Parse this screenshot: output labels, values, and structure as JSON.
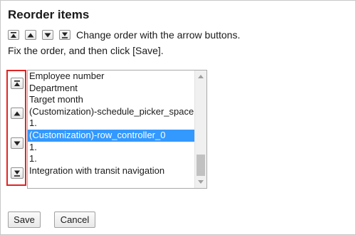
{
  "header": {
    "title": "Reorder items"
  },
  "instructions": {
    "line1": "Change order with the arrow buttons.",
    "line2": "Fix the order, and then click [Save]."
  },
  "legend_icons": [
    "move-to-top-icon",
    "move-up-icon",
    "move-down-icon",
    "move-to-bottom-icon"
  ],
  "arrow_buttons": [
    "move-to-top-icon",
    "move-up-icon",
    "move-down-icon",
    "move-to-bottom-icon"
  ],
  "list": {
    "items": [
      "Employee number",
      "Department",
      "Target month",
      "(Customization)-schedule_picker_space",
      "1.",
      "(Customization)-row_controller_0",
      "1.",
      "1.",
      "Integration with transit navigation"
    ],
    "selected_index": 5
  },
  "buttons": {
    "save": "Save",
    "cancel": "Cancel"
  },
  "colors": {
    "selection": "#3399ff",
    "highlight_border": "#e02424"
  }
}
